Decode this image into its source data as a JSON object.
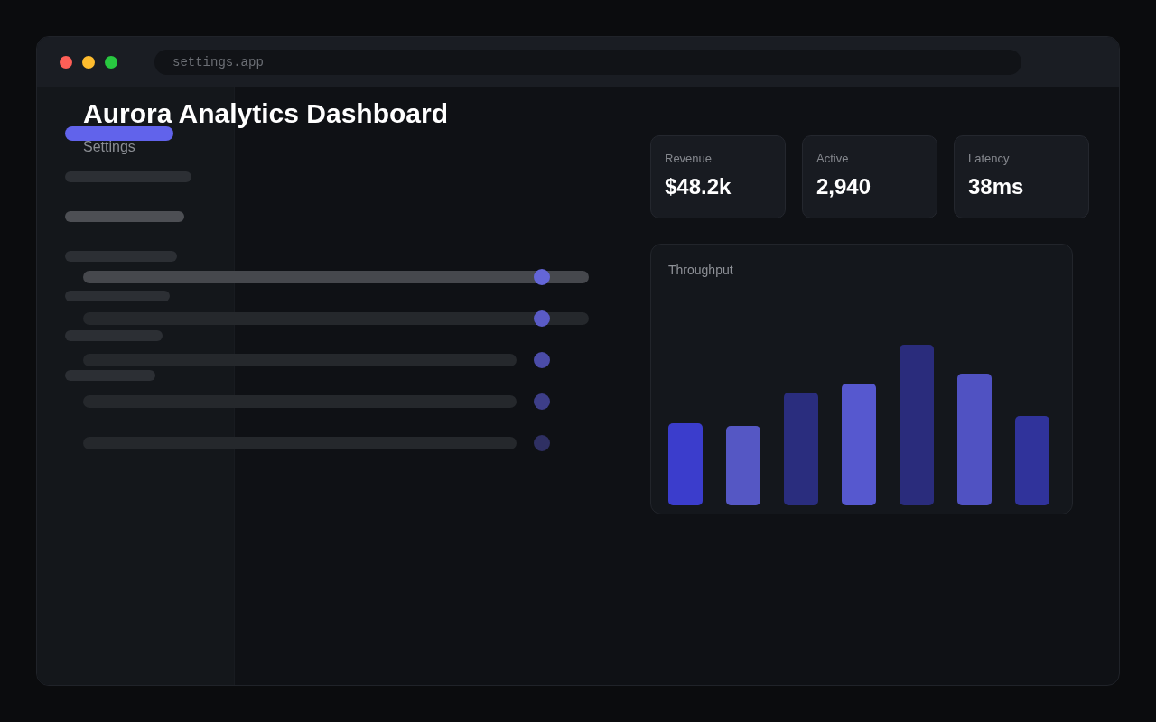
{
  "window": {
    "address": "settings.app"
  },
  "sidebar": {
    "items": [
      {
        "selected": true,
        "hovered": false
      },
      {
        "selected": false,
        "hovered": false
      },
      {
        "selected": false,
        "hovered": true
      },
      {
        "selected": false,
        "hovered": false
      },
      {
        "selected": false,
        "hovered": false
      },
      {
        "selected": false,
        "hovered": false
      },
      {
        "selected": false,
        "hovered": false
      }
    ]
  },
  "header": {
    "title": "Aurora Analytics Dashboard",
    "subtitle": "Settings"
  },
  "settings_rows": [
    {
      "kind": "slider",
      "selected": true,
      "level": 0.907,
      "color": "#6466d8"
    },
    {
      "kind": "slider",
      "selected": false,
      "level": 0.907,
      "color": "#5a5bc6"
    },
    {
      "kind": "dot",
      "color": "#4b4ca8"
    },
    {
      "kind": "dot",
      "color": "#3d3e88"
    },
    {
      "kind": "dot",
      "color": "#2f3063"
    }
  ],
  "stats": [
    {
      "label": "Revenue",
      "value": "$48.2k"
    },
    {
      "label": "Active",
      "value": "2,940"
    },
    {
      "label": "Latency",
      "value": "38ms"
    }
  ],
  "chart": {
    "title": "Throughput"
  }
}
